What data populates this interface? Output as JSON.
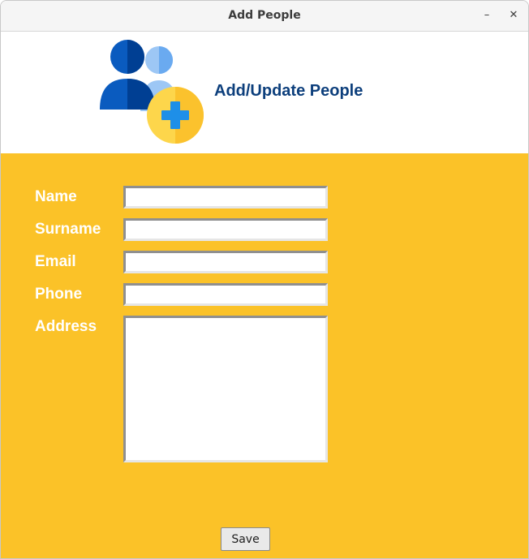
{
  "window": {
    "title": "Add People",
    "minimize_glyph": "–",
    "close_glyph": "✕"
  },
  "header": {
    "heading": "Add/Update People",
    "logo_icon": "add-people-icon"
  },
  "form": {
    "fields": [
      {
        "label": "Name",
        "value": ""
      },
      {
        "label": "Surname",
        "value": ""
      },
      {
        "label": "Email",
        "value": ""
      },
      {
        "label": "Phone",
        "value": ""
      },
      {
        "label": "Address",
        "value": ""
      }
    ],
    "save_label": "Save"
  },
  "colors": {
    "form_background": "#fbc228",
    "heading_text": "#0d3f7c",
    "label_text": "#ffffff"
  }
}
